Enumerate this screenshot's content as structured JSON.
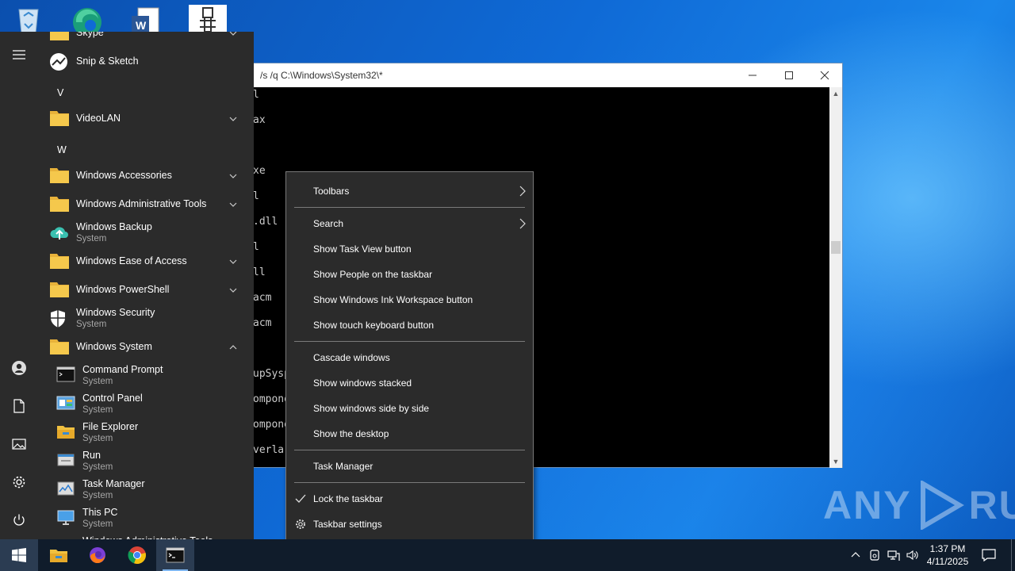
{
  "desktop": {
    "icons": [
      "recycle-bin",
      "edge",
      "word-document",
      "program-shortcut"
    ],
    "watermark": "ANY RUN"
  },
  "console": {
    "title": "/s /q C:\\Windows\\System32\\*",
    "lines": [
      "l",
      "ax",
      "",
      "xe",
      "l",
      ".dll",
      "l",
      "ll",
      "acm",
      "acm",
      "",
      "upSysp",
      "ompone",
      "ompone",
      "verla"
    ]
  },
  "start_menu": {
    "rail": [
      "hamburger-menu",
      "user-account",
      "documents",
      "pictures",
      "settings",
      "power"
    ],
    "entries": [
      {
        "type": "folder",
        "name": "Skype",
        "expand": "down"
      },
      {
        "type": "app",
        "name": "Snip & Sketch",
        "icon": "snip-sketch"
      },
      {
        "type": "letter",
        "name": "V"
      },
      {
        "type": "folder",
        "name": "VideoLAN",
        "expand": "down"
      },
      {
        "type": "letter",
        "name": "W"
      },
      {
        "type": "folder",
        "name": "Windows Accessories",
        "expand": "down"
      },
      {
        "type": "folder",
        "name": "Windows Administrative Tools",
        "expand": "down"
      },
      {
        "type": "app",
        "name": "Windows Backup",
        "detail": "System",
        "icon": "backup"
      },
      {
        "type": "folder",
        "name": "Windows Ease of Access",
        "expand": "down"
      },
      {
        "type": "folder",
        "name": "Windows PowerShell",
        "expand": "down"
      },
      {
        "type": "app",
        "name": "Windows Security",
        "detail": "System",
        "icon": "shield"
      },
      {
        "type": "folder",
        "name": "Windows System",
        "expand": "up"
      },
      {
        "type": "sub",
        "name": "Command Prompt",
        "detail": "System",
        "icon": "cmd"
      },
      {
        "type": "sub",
        "name": "Control Panel",
        "detail": "System",
        "icon": "control-panel"
      },
      {
        "type": "sub",
        "name": "File Explorer",
        "detail": "System",
        "icon": "file-explorer"
      },
      {
        "type": "sub",
        "name": "Run",
        "detail": "System",
        "icon": "run"
      },
      {
        "type": "sub",
        "name": "Task Manager",
        "detail": "System",
        "icon": "task-manager"
      },
      {
        "type": "sub",
        "name": "This PC",
        "detail": "System",
        "icon": "this-pc"
      },
      {
        "type": "sub",
        "name": "Windows Administrative Tools",
        "detail": "",
        "icon": "admin-tools"
      }
    ]
  },
  "context_menu": {
    "items": [
      {
        "label": "Toolbars",
        "submenu": true
      },
      {
        "separator": true
      },
      {
        "label": "Search",
        "submenu": true
      },
      {
        "label": "Show Task View button"
      },
      {
        "label": "Show People on the taskbar"
      },
      {
        "label": "Show Windows Ink Workspace button"
      },
      {
        "label": "Show touch keyboard button"
      },
      {
        "separator": true
      },
      {
        "label": "Cascade windows"
      },
      {
        "label": "Show windows stacked"
      },
      {
        "label": "Show windows side by side"
      },
      {
        "label": "Show the desktop"
      },
      {
        "separator": true
      },
      {
        "label": "Task Manager"
      },
      {
        "separator": true
      },
      {
        "label": "Lock the taskbar",
        "checked": true
      },
      {
        "label": "Taskbar settings",
        "icon": "gear"
      }
    ]
  },
  "taskbar": {
    "pinned": [
      "file-explorer",
      "firefox",
      "chrome",
      "command-prompt"
    ],
    "active": "command-prompt",
    "tray": [
      "chevron-up",
      "device",
      "network",
      "volume"
    ],
    "time": "1:37 PM",
    "date": "4/11/2025"
  },
  "colors": {
    "menu_bg": "#2b2b2b",
    "taskbar_bg": "#101c2b",
    "folder_yellow": "#f0c040",
    "accent": "#0078d7"
  }
}
